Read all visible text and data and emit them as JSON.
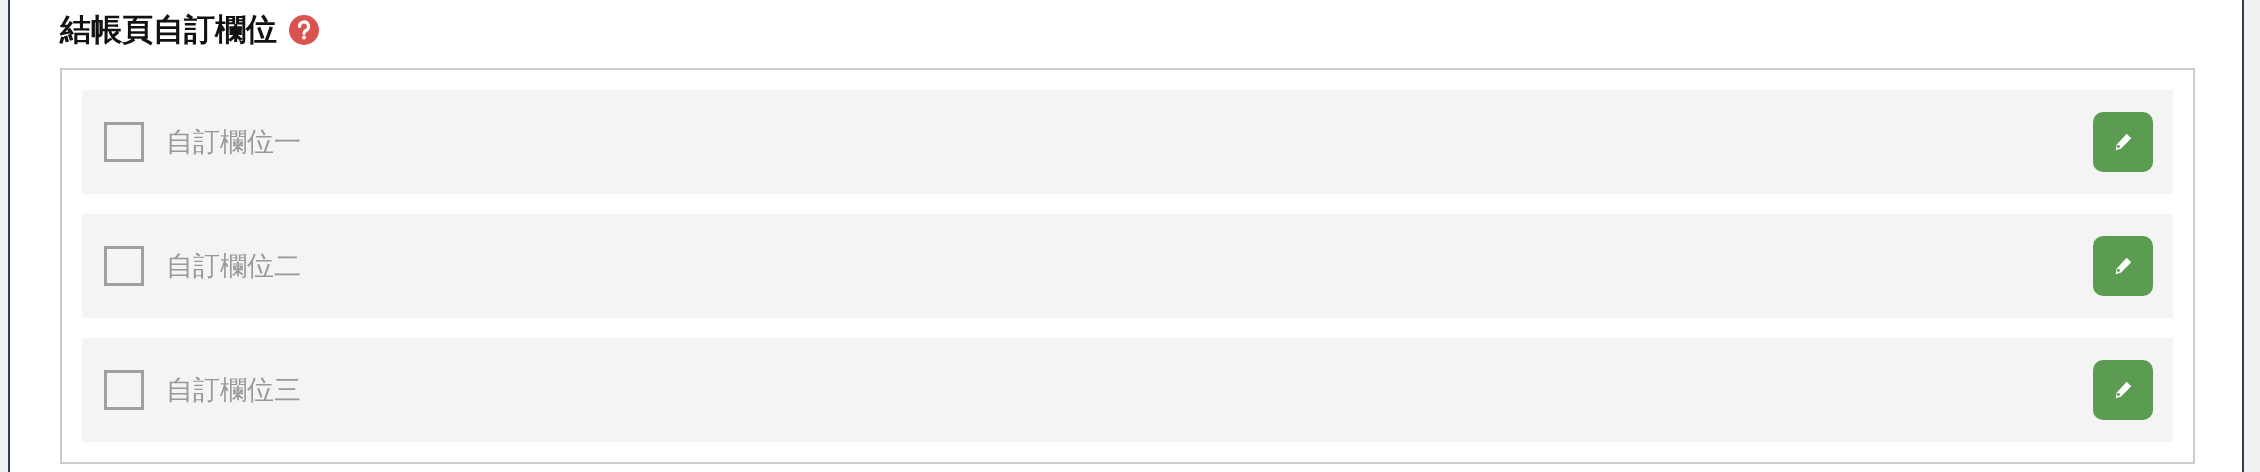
{
  "section": {
    "title": "結帳頁自訂欄位"
  },
  "fields": [
    {
      "label": "自訂欄位一",
      "checked": false
    },
    {
      "label": "自訂欄位二",
      "checked": false
    },
    {
      "label": "自訂欄位三",
      "checked": false
    }
  ]
}
